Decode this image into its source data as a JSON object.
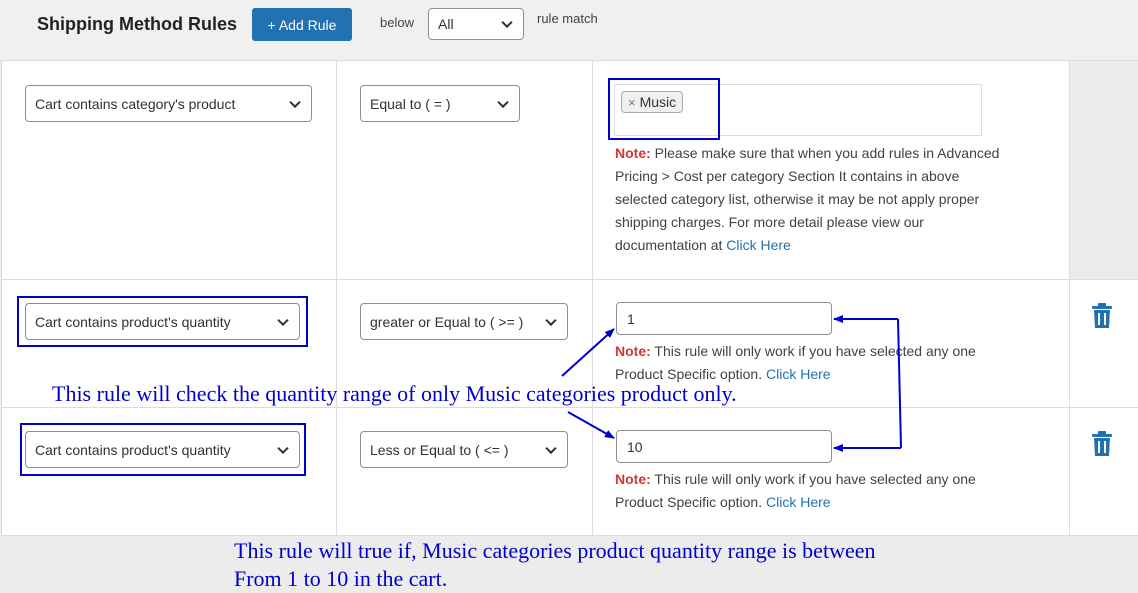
{
  "header": {
    "title": "Shipping Method Rules",
    "add_rule_label": "+ Add Rule",
    "below_label": "below",
    "match_select_value": "All",
    "rule_match_label": "rule match"
  },
  "rules": [
    {
      "condition": "Cart contains category's product",
      "operator": "Equal to ( = )",
      "tag_remove": "×",
      "tag": "Music",
      "note_label": "Note:",
      "note_lines": [
        "Please make sure that when you add rules in Advanced",
        "Pricing > Cost per category Section It contains in above",
        "selected category list, otherwise it may be not apply proper",
        "shipping charges. For more detail please view our"
      ],
      "note_last_prefix": "documentation at",
      "note_link": "Click Here"
    },
    {
      "condition": "Cart contains product's quantity",
      "operator": "greater or Equal to ( >= )",
      "value": "1",
      "note_label": "Note:",
      "note_line1": "This rule will only work if you have selected any one",
      "note_line2": "Product Specific option.",
      "note_link": "Click Here"
    },
    {
      "condition": "Cart contains product's quantity",
      "operator": "Less or Equal to ( <= )",
      "value": "10",
      "note_label": "Note:",
      "note_line1": "This rule will only work if you have selected any one",
      "note_line2": "Product Specific option.",
      "note_link": "Click Here"
    }
  ],
  "annotations": {
    "middle_text": "This rule will check the quantity range of only Music categories product only.",
    "bottom_line1": "This rule will true if, Music categories product quantity range is between",
    "bottom_line2": "From 1 to 10 in the cart.",
    "color": "#0000cc"
  },
  "icons": {
    "delete": "trash-icon",
    "dropdown": "chevron-down-icon"
  },
  "colors": {
    "primary_button": "#2271b1",
    "note_label": "#d63638",
    "link": "#2271b1",
    "annotation": "#0000cc"
  }
}
